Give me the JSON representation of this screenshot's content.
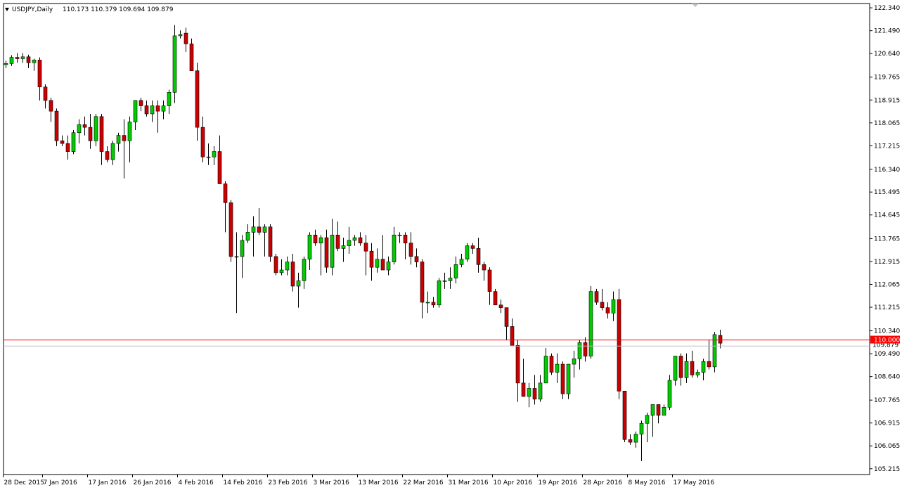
{
  "chart_data": {
    "type": "candlestick",
    "symbol_line": "USDJPY,Daily",
    "ohlc_line": "110.173 110.379 109.694 109.879",
    "ylim": [
      105.0,
      122.5
    ],
    "y_ticks": [
      "122.340",
      "121.490",
      "120.640",
      "119.765",
      "118.915",
      "118.065",
      "117.215",
      "116.340",
      "115.495",
      "114.645",
      "113.765",
      "112.915",
      "112.065",
      "111.215",
      "110.340",
      "109.490",
      "108.640",
      "107.765",
      "106.915",
      "106.065",
      "105.215"
    ],
    "x_tick_labels": [
      {
        "i": 0,
        "label": "28 Dec 2015"
      },
      {
        "i": 7,
        "label": "7 Jan 2016"
      },
      {
        "i": 15,
        "label": "17 Jan 2016"
      },
      {
        "i": 23,
        "label": "26 Jan 2016"
      },
      {
        "i": 31,
        "label": "4 Feb 2016"
      },
      {
        "i": 39,
        "label": "14 Feb 2016"
      },
      {
        "i": 47,
        "label": "23 Feb 2016"
      },
      {
        "i": 55,
        "label": "3 Mar 2016"
      },
      {
        "i": 63,
        "label": "13 Mar 2016"
      },
      {
        "i": 71,
        "label": "22 Mar 2016"
      },
      {
        "i": 79,
        "label": "31 Mar 2016"
      },
      {
        "i": 87,
        "label": "10 Apr 2016"
      },
      {
        "i": 95,
        "label": "19 Apr 2016"
      },
      {
        "i": 103,
        "label": "28 Apr 2016"
      },
      {
        "i": 111,
        "label": "8 May 2016"
      },
      {
        "i": 119,
        "label": "17 May 2016"
      }
    ],
    "current_price": "110.000",
    "bid_price": "109.879",
    "colors": {
      "up": "#00cc00",
      "down": "#cc0000",
      "wick": "#000000",
      "current_line": "#ff0000",
      "bid_line": "#c0c0c0"
    },
    "candles": [
      [
        120.23,
        120.37,
        120.1,
        120.27
      ],
      [
        120.27,
        120.58,
        120.18,
        120.5
      ],
      [
        120.5,
        120.66,
        120.3,
        120.45
      ],
      [
        120.45,
        120.66,
        120.3,
        120.52
      ],
      [
        120.52,
        120.6,
        120.1,
        120.3
      ],
      [
        120.3,
        120.45,
        120.0,
        120.4
      ],
      [
        120.4,
        120.5,
        118.9,
        119.4
      ],
      [
        119.4,
        119.5,
        118.6,
        118.9
      ],
      [
        118.9,
        119.0,
        118.1,
        118.5
      ],
      [
        118.5,
        118.6,
        117.2,
        117.4
      ],
      [
        117.4,
        117.6,
        117.2,
        117.3
      ],
      [
        117.3,
        117.6,
        116.7,
        117.0
      ],
      [
        117.0,
        117.8,
        116.9,
        117.7
      ],
      [
        117.7,
        118.2,
        117.3,
        118.0
      ],
      [
        118.0,
        118.3,
        117.6,
        117.9
      ],
      [
        117.9,
        118.4,
        117.1,
        117.4
      ],
      [
        117.4,
        118.4,
        117.2,
        118.3
      ],
      [
        118.3,
        118.4,
        116.5,
        117.0
      ],
      [
        117.0,
        117.2,
        116.6,
        116.7
      ],
      [
        116.7,
        117.4,
        116.5,
        117.3
      ],
      [
        117.3,
        117.7,
        117.0,
        117.6
      ],
      [
        117.6,
        118.2,
        116.0,
        117.4
      ],
      [
        117.4,
        118.3,
        116.6,
        118.1
      ],
      [
        118.1,
        118.9,
        117.8,
        118.9
      ],
      [
        118.9,
        119.0,
        118.5,
        118.7
      ],
      [
        118.7,
        118.9,
        118.3,
        118.4
      ],
      [
        118.4,
        118.9,
        118.1,
        118.7
      ],
      [
        118.7,
        118.9,
        117.7,
        118.5
      ],
      [
        118.5,
        118.9,
        118.2,
        118.7
      ],
      [
        118.7,
        119.3,
        118.4,
        119.2
      ],
      [
        119.2,
        121.7,
        118.8,
        121.3
      ],
      [
        121.3,
        121.5,
        121.2,
        121.35
      ],
      [
        121.4,
        121.6,
        120.7,
        121.0
      ],
      [
        121.0,
        121.2,
        120.1,
        120.0
      ],
      [
        120.0,
        120.3,
        117.4,
        117.9
      ],
      [
        117.9,
        118.3,
        116.6,
        116.8
      ],
      [
        116.8,
        117.3,
        116.5,
        116.8
      ],
      [
        116.8,
        117.2,
        116.5,
        117.0
      ],
      [
        117.0,
        117.6,
        116.5,
        115.8
      ],
      [
        115.8,
        115.9,
        114.0,
        115.1
      ],
      [
        115.1,
        115.2,
        112.9,
        113.1
      ],
      [
        113.1,
        114.0,
        111.0,
        113.1
      ],
      [
        113.1,
        113.9,
        112.3,
        113.7
      ],
      [
        113.7,
        114.3,
        113.6,
        114.0
      ],
      [
        114.0,
        114.6,
        113.1,
        114.2
      ],
      [
        114.2,
        114.9,
        113.9,
        114.0
      ],
      [
        114.0,
        114.3,
        113.1,
        114.2
      ],
      [
        114.2,
        114.3,
        112.9,
        113.1
      ],
      [
        113.1,
        113.2,
        112.4,
        112.5
      ],
      [
        112.5,
        113.0,
        112.4,
        112.6
      ],
      [
        112.6,
        113.1,
        112.4,
        112.9
      ],
      [
        112.9,
        113.2,
        111.8,
        112.0
      ],
      [
        112.0,
        112.5,
        111.2,
        112.2
      ],
      [
        112.2,
        113.1,
        111.9,
        113.0
      ],
      [
        113.0,
        114.0,
        112.6,
        113.9
      ],
      [
        113.9,
        114.1,
        113.5,
        113.6
      ],
      [
        113.6,
        113.9,
        112.4,
        113.8
      ],
      [
        113.8,
        114.1,
        112.5,
        112.7
      ],
      [
        112.7,
        114.5,
        112.4,
        113.9
      ],
      [
        113.9,
        114.4,
        113.3,
        113.4
      ],
      [
        113.4,
        113.8,
        112.9,
        113.5
      ],
      [
        113.5,
        114.2,
        113.2,
        113.7
      ],
      [
        113.7,
        113.9,
        113.5,
        113.8
      ],
      [
        113.8,
        114.0,
        113.5,
        113.6
      ],
      [
        113.6,
        113.9,
        112.4,
        113.3
      ],
      [
        113.3,
        113.6,
        112.2,
        112.7
      ],
      [
        112.7,
        113.4,
        112.5,
        113.0
      ],
      [
        113.0,
        113.9,
        112.6,
        112.6
      ],
      [
        112.6,
        113.1,
        112.4,
        112.9
      ],
      [
        112.9,
        114.2,
        112.8,
        113.9
      ],
      [
        113.9,
        114.0,
        113.6,
        113.9
      ],
      [
        113.9,
        114.0,
        113.0,
        113.6
      ],
      [
        113.6,
        114.0,
        112.8,
        113.1
      ],
      [
        113.1,
        113.4,
        112.7,
        112.9
      ],
      [
        112.9,
        113.0,
        110.8,
        111.4
      ],
      [
        111.4,
        111.8,
        111.0,
        111.4
      ],
      [
        111.4,
        111.6,
        111.2,
        111.3
      ],
      [
        111.3,
        112.3,
        111.2,
        112.2
      ],
      [
        112.2,
        112.5,
        111.9,
        112.2
      ],
      [
        112.2,
        112.7,
        111.9,
        112.3
      ],
      [
        112.3,
        113.1,
        112.1,
        112.8
      ],
      [
        112.8,
        113.2,
        112.7,
        113.0
      ],
      [
        113.0,
        113.6,
        112.9,
        113.5
      ],
      [
        113.5,
        113.6,
        113.2,
        113.4
      ],
      [
        113.4,
        113.8,
        112.5,
        112.8
      ],
      [
        112.8,
        112.9,
        112.2,
        112.6
      ],
      [
        112.6,
        112.7,
        111.3,
        111.8
      ],
      [
        111.8,
        111.9,
        111.3,
        111.3
      ],
      [
        111.3,
        111.5,
        111.0,
        111.2
      ],
      [
        111.2,
        111.2,
        110.0,
        110.5
      ],
      [
        110.5,
        110.8,
        109.9,
        109.8
      ],
      [
        109.8,
        110.0,
        107.7,
        108.4
      ],
      [
        108.4,
        109.3,
        108.0,
        107.9
      ],
      [
        107.9,
        108.4,
        107.5,
        108.2
      ],
      [
        108.2,
        108.7,
        107.6,
        107.8
      ],
      [
        107.8,
        108.7,
        107.7,
        108.4
      ],
      [
        108.4,
        109.7,
        108.4,
        109.4
      ],
      [
        109.4,
        109.5,
        108.7,
        108.8
      ],
      [
        108.8,
        109.5,
        108.4,
        109.1
      ],
      [
        109.1,
        109.2,
        107.8,
        108.0
      ],
      [
        108.0,
        109.1,
        107.8,
        109.1
      ],
      [
        109.1,
        109.6,
        108.6,
        109.3
      ],
      [
        109.3,
        110.0,
        108.9,
        109.9
      ],
      [
        109.9,
        110.1,
        109.2,
        109.4
      ],
      [
        109.4,
        112.0,
        109.3,
        111.8
      ],
      [
        111.8,
        111.9,
        111.3,
        111.4
      ],
      [
        111.4,
        111.9,
        111.1,
        111.2
      ],
      [
        111.2,
        111.4,
        110.8,
        111.0
      ],
      [
        111.0,
        111.8,
        110.7,
        111.5
      ],
      [
        111.5,
        111.9,
        107.8,
        108.1
      ],
      [
        108.1,
        108.1,
        106.2,
        106.3
      ],
      [
        106.3,
        106.5,
        106.1,
        106.2
      ],
      [
        106.2,
        106.6,
        106.0,
        106.5
      ],
      [
        106.5,
        107.0,
        105.5,
        106.9
      ],
      [
        106.9,
        107.3,
        106.2,
        107.2
      ],
      [
        107.2,
        107.6,
        106.4,
        107.6
      ],
      [
        107.6,
        107.6,
        106.9,
        107.2
      ],
      [
        107.2,
        107.6,
        107.2,
        107.5
      ],
      [
        107.5,
        108.7,
        107.4,
        108.5
      ],
      [
        108.5,
        109.4,
        108.3,
        109.4
      ],
      [
        109.4,
        109.5,
        108.3,
        108.6
      ],
      [
        108.6,
        109.5,
        108.4,
        109.2
      ],
      [
        109.2,
        109.6,
        108.6,
        108.7
      ],
      [
        108.7,
        108.9,
        108.6,
        108.8
      ],
      [
        108.8,
        109.3,
        108.5,
        109.2
      ],
      [
        109.2,
        110.0,
        108.9,
        109.0
      ],
      [
        109.0,
        110.3,
        108.8,
        110.2
      ],
      [
        110.17,
        110.38,
        109.69,
        109.88
      ]
    ]
  }
}
